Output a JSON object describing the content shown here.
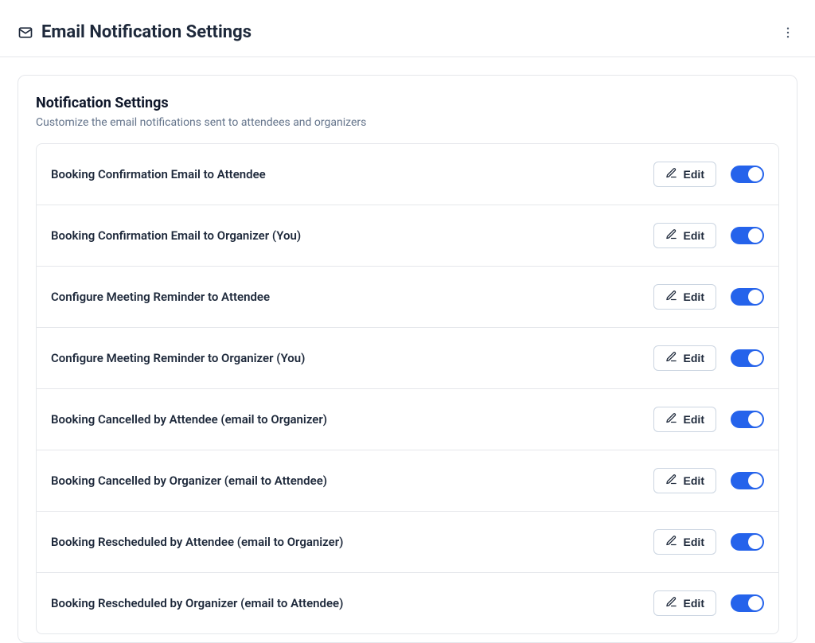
{
  "header": {
    "title": "Email Notification Settings"
  },
  "panel": {
    "title": "Notification Settings",
    "subtitle": "Customize the email notifications sent to attendees and organizers"
  },
  "edit_label": "Edit",
  "notifications": [
    {
      "label": "Booking Confirmation Email to Attendee",
      "enabled": true
    },
    {
      "label": "Booking Confirmation Email to Organizer (You)",
      "enabled": true
    },
    {
      "label": "Configure Meeting Reminder to Attendee",
      "enabled": true
    },
    {
      "label": "Configure Meeting Reminder to Organizer (You)",
      "enabled": true
    },
    {
      "label": "Booking Cancelled by Attendee (email to Organizer)",
      "enabled": true
    },
    {
      "label": "Booking Cancelled by Organizer (email to Attendee)",
      "enabled": true
    },
    {
      "label": "Booking Rescheduled by Attendee (email to Organizer)",
      "enabled": true
    },
    {
      "label": "Booking Rescheduled by Organizer (email to Attendee)",
      "enabled": true
    }
  ]
}
